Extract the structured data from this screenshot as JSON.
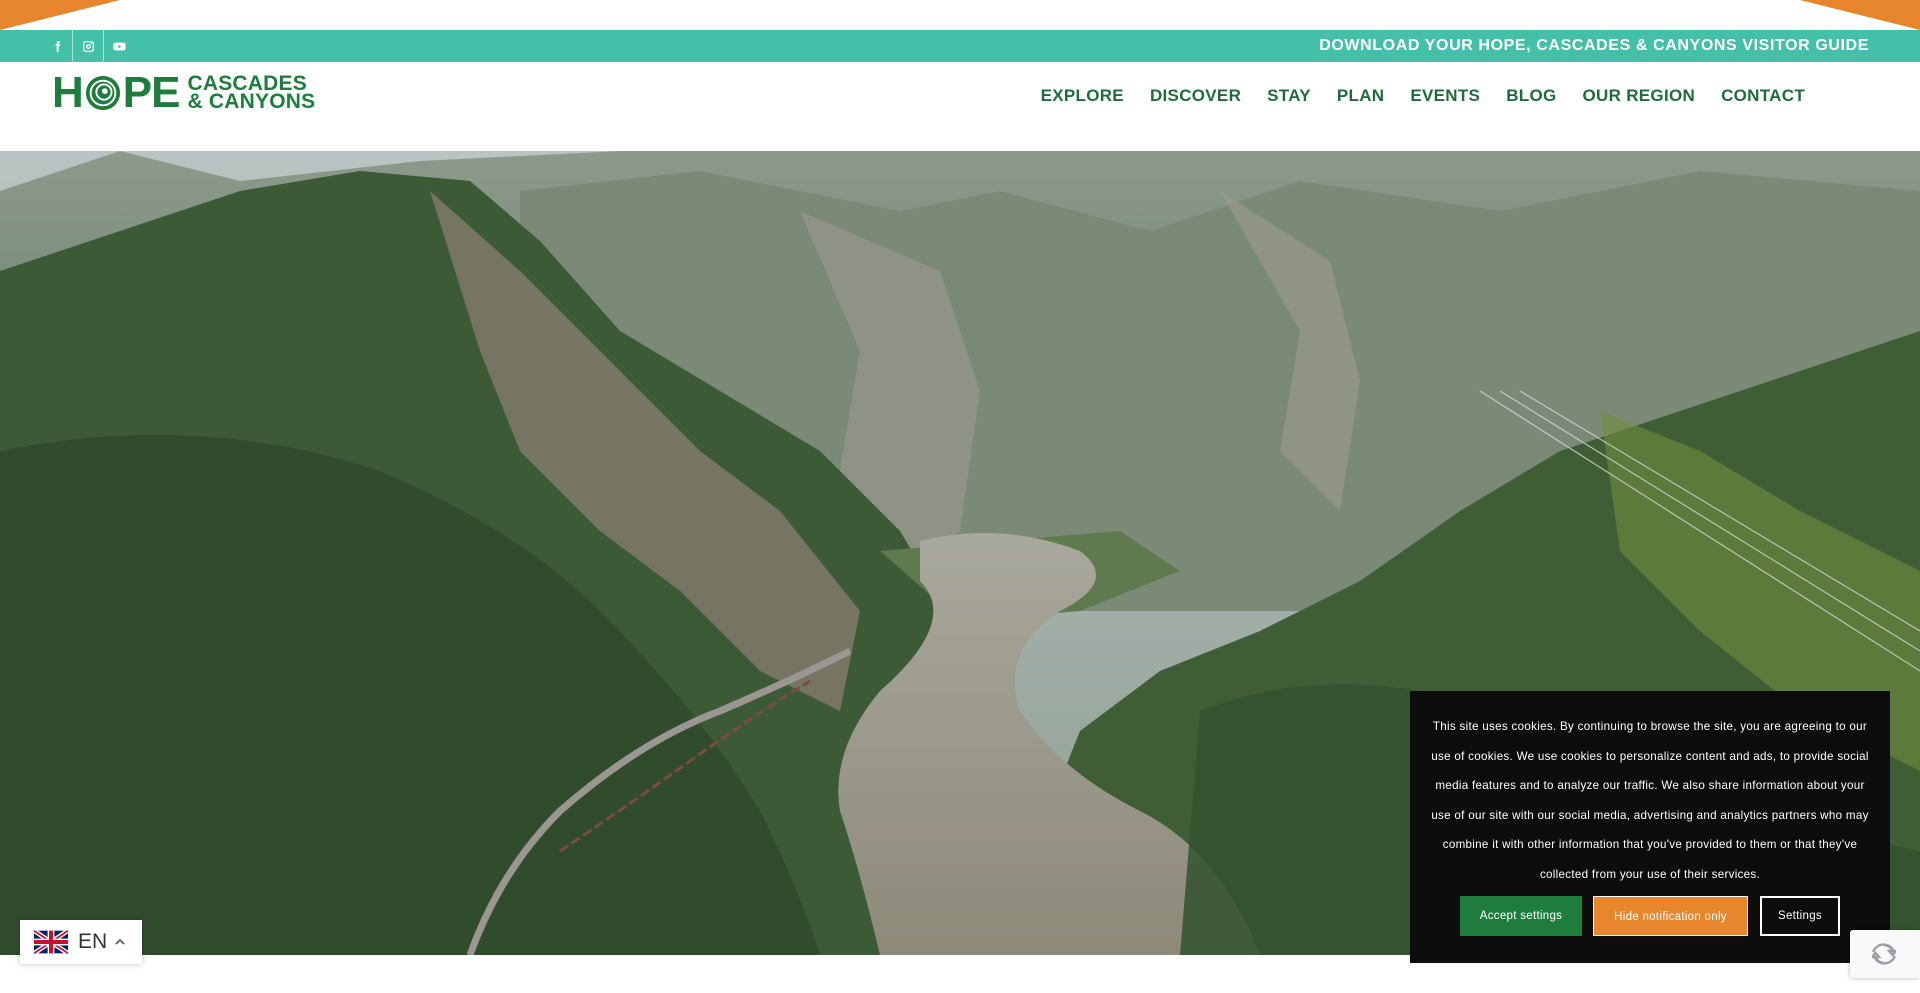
{
  "topbar": {
    "social": [
      {
        "icon": "facebook-icon"
      },
      {
        "icon": "instagram-icon"
      },
      {
        "icon": "youtube-icon"
      }
    ],
    "guide_link": "DOWNLOAD YOUR HOPE, CASCADES & CANYONS VISITOR GUIDE"
  },
  "header": {
    "logo": {
      "part1": "H",
      "part2": "PE",
      "line1": "CASCADES",
      "line2": "& CANYONS"
    },
    "nav": [
      "EXPLORE",
      "DISCOVER",
      "STAY",
      "PLAN",
      "EVENTS",
      "BLOG",
      "OUR REGION",
      "CONTACT"
    ]
  },
  "cookie": {
    "text": "This site uses cookies. By continuing to browse the site, you are agreeing to our use of cookies. We use cookies to personalize content and ads, to provide social media features and to analyze our traffic. We also share information about your use of our site with our social media, advertising and analytics partners who may combine it with other information that you've provided to them or that they've collected from your use of their services.",
    "accept": "Accept settings",
    "hide": "Hide notification only",
    "settings": "Settings"
  },
  "language": {
    "code": "EN",
    "flag": "uk-flag-icon"
  },
  "colors": {
    "teal": "#44bfa8",
    "green": "#1e7d3d",
    "orange": "#e8862e"
  }
}
